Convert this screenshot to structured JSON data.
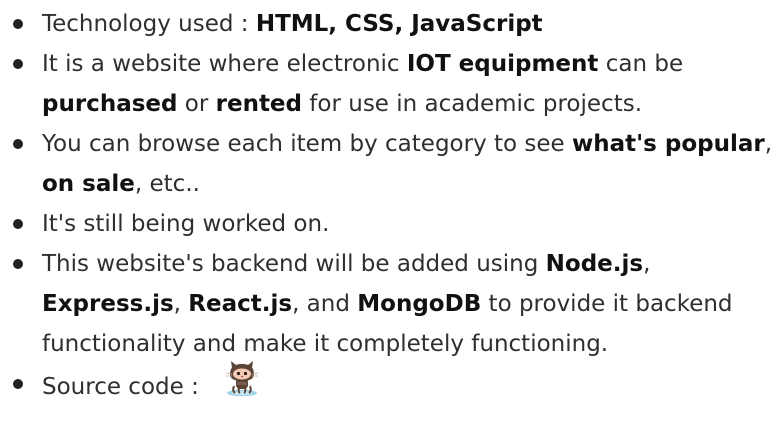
{
  "items": [
    {
      "segments": [
        {
          "t": "Technology used : ",
          "b": false
        },
        {
          "t": "HTML, CSS, JavaScript",
          "b": true
        }
      ]
    },
    {
      "segments": [
        {
          "t": "It is a website where electronic ",
          "b": false
        },
        {
          "t": "IOT equipment",
          "b": true
        },
        {
          "t": " can be ",
          "b": false
        },
        {
          "t": "purchased",
          "b": true
        },
        {
          "t": " or ",
          "b": false
        },
        {
          "t": "rented",
          "b": true
        },
        {
          "t": " for use in academic projects.",
          "b": false
        }
      ]
    },
    {
      "segments": [
        {
          "t": "You can browse each item by category to see ",
          "b": false
        },
        {
          "t": "what's popular",
          "b": true
        },
        {
          "t": ", ",
          "b": false
        },
        {
          "t": "on sale",
          "b": true
        },
        {
          "t": ", etc..",
          "b": false
        }
      ]
    },
    {
      "segments": [
        {
          "t": "It's still being worked on.",
          "b": false
        }
      ]
    },
    {
      "segments": [
        {
          "t": "This website's backend will be added using ",
          "b": false
        },
        {
          "t": "Node.js",
          "b": true
        },
        {
          "t": ", ",
          "b": false
        },
        {
          "t": "Express.js",
          "b": true
        },
        {
          "t": ", ",
          "b": false
        },
        {
          "t": "React.js",
          "b": true
        },
        {
          "t": ", and ",
          "b": false
        },
        {
          "t": "MongoDB",
          "b": true
        },
        {
          "t": " to provide it backend functionality and make it completely functioning.",
          "b": false
        }
      ]
    },
    {
      "segments": [
        {
          "t": "Source code : ",
          "b": false
        }
      ],
      "icon": "github-octocat-icon"
    }
  ],
  "colors": {
    "text": "#2f2f2f",
    "bold_text": "#111111",
    "bullet": "#222222"
  }
}
